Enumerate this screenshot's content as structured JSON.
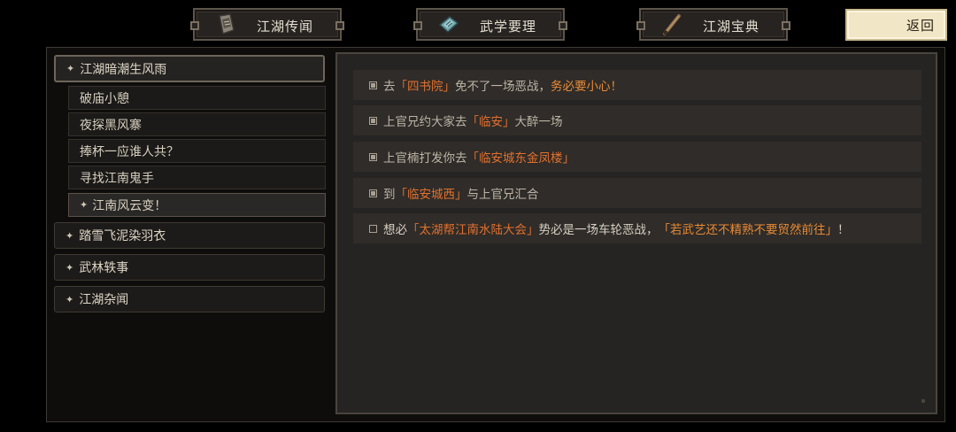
{
  "tabs": [
    {
      "label": "江湖传闻",
      "icon": "scroll-icon"
    },
    {
      "label": "武学要理",
      "icon": "book-icon"
    },
    {
      "label": "江湖宝典",
      "icon": "brush-icon"
    }
  ],
  "back_label": "返回",
  "sidebar": {
    "groups": [
      {
        "label": "江湖暗潮生风雨",
        "expanded": true,
        "items": [
          {
            "label": "破庙小憩"
          },
          {
            "label": "夜探黑风寨"
          },
          {
            "label": "捧杯一应谁人共？"
          },
          {
            "label": "寻找江南鬼手"
          },
          {
            "label": "江南风云变！",
            "selected": true
          }
        ]
      },
      {
        "label": "踏雪飞泥染羽衣"
      },
      {
        "label": "武林轶事"
      },
      {
        "label": "江湖杂闻"
      }
    ]
  },
  "quests": [
    {
      "done": true,
      "parts": {
        "a": "去",
        "b": "「四书院」",
        "c": "免不了一场恶战，",
        "d": "务必要小心！"
      }
    },
    {
      "done": true,
      "parts": {
        "a": "上官兄约大家去",
        "b": "「临安」",
        "c": "大醉一场"
      }
    },
    {
      "done": true,
      "parts": {
        "a": "上官楠打发你去",
        "b": "「临安城东金凤楼」"
      }
    },
    {
      "done": true,
      "parts": {
        "a": "到",
        "b": "「临安城西」",
        "c": "与上官兄汇合"
      }
    },
    {
      "done": false,
      "parts": {
        "a": "想必",
        "b": "「太湖帮江南水陆大会」",
        "c": "势必是一场车轮恶战，",
        "d": "「若武艺还不精熟不要贸然前往」",
        "e": "！"
      }
    }
  ]
}
